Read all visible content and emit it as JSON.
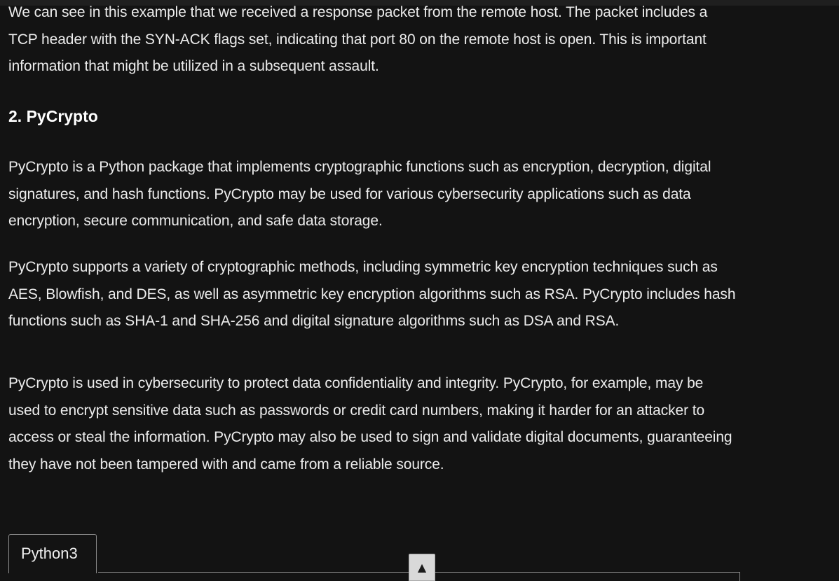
{
  "article": {
    "paragraphs_intro": {
      "p1": "We can see in this example that we received a response packet from the remote host. The packet includes a TCP header with the SYN-ACK flags set, indicating that port 80 on the remote host is open. This is important information that might be utilized in a subsequent assault."
    },
    "section_heading": "2. PyCrypto",
    "section_paragraphs": {
      "p2": "PyCrypto is a Python package that implements cryptographic functions such as encryption, decryption, digital signatures, and hash functions. PyCrypto may be used for various cybersecurity applications such as data encryption, secure communication, and safe data storage.",
      "p3": "PyCrypto supports a variety of cryptographic methods, including symmetric key encryption techniques such as AES, Blowfish, and DES, as well as asymmetric key encryption algorithms such as RSA. PyCrypto includes hash functions such as SHA-1 and SHA-256 and digital signature algorithms such as DSA and RSA.",
      "p4": "PyCrypto is used in cybersecurity to protect data confidentiality and integrity. PyCrypto, for example, may be used to encrypt sensitive data such as passwords or credit card numbers, making it harder for an attacker to access or steal the information. PyCrypto may also be used to sign and validate digital documents, guaranteeing they have not been tampered with and came from a reliable source."
    }
  },
  "code_block": {
    "tab_label": "Python3"
  },
  "scroll_to_top": {
    "icon": "triangle-up-icon",
    "glyph": "▲"
  }
}
